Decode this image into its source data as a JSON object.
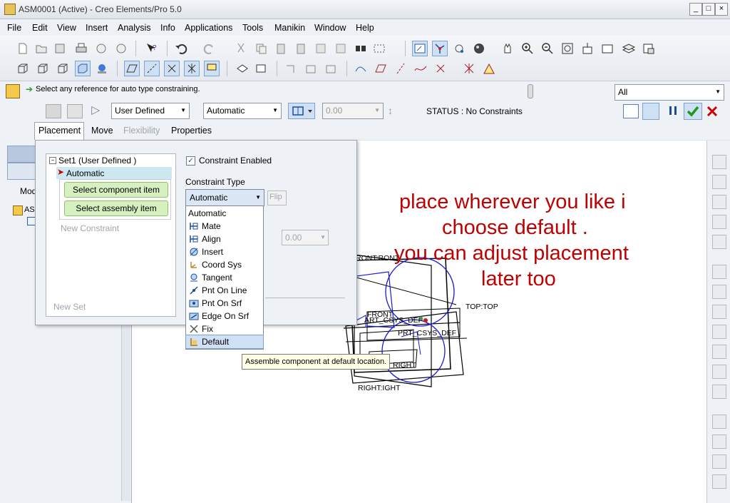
{
  "window": {
    "title": "ASM0001 (Active) - Creo Elements/Pro 5.0",
    "min": "_",
    "max": "□",
    "close": "×"
  },
  "menubar": [
    "File",
    "Edit",
    "View",
    "Insert",
    "Analysis",
    "Info",
    "Applications",
    "Tools",
    "Manikin",
    "Window",
    "Help"
  ],
  "message": {
    "text": "Select any reference for auto type constraining.",
    "filter": "All"
  },
  "dashboard": {
    "set_type": "User Defined",
    "constraint": "Automatic",
    "offset": "0.00",
    "status": "STATUS : No Constraints",
    "tabs": [
      "Placement",
      "Move",
      "Flexibility",
      "Properties"
    ]
  },
  "placement": {
    "set_label": "Set1 (User Defined )",
    "selected_constraint": "Automatic",
    "select_component": "Select component item",
    "select_assembly": "Select assembly item",
    "new_constraint": "New Constraint",
    "new_set": "New Set",
    "constraint_enabled": "Constraint Enabled",
    "constraint_type_label": "Constraint Type",
    "constraint_type_value": "Automatic",
    "flip": "Flip",
    "offset_value": "0.00"
  },
  "constraint_types": [
    {
      "label": "Automatic",
      "icon": ""
    },
    {
      "label": "Mate",
      "icon": "mate-icon"
    },
    {
      "label": "Align",
      "icon": "align-icon"
    },
    {
      "label": "Insert",
      "icon": "insert-icon"
    },
    {
      "label": "Coord Sys",
      "icon": "coord-sys-icon"
    },
    {
      "label": "Tangent",
      "icon": "tangent-icon"
    },
    {
      "label": "Pnt On Line",
      "icon": "pnt-on-line-icon"
    },
    {
      "label": "Pnt On Srf",
      "icon": "pnt-on-srf-icon"
    },
    {
      "label": "Edge On Srf",
      "icon": "edge-on-srf-icon"
    },
    {
      "label": "Fix",
      "icon": "fix-icon"
    },
    {
      "label": "Default",
      "icon": "default-icon"
    }
  ],
  "tooltip": "Assemble component at default location.",
  "model_tree": {
    "header": "Mod",
    "root": "ASI"
  },
  "viewport_labels": {
    "front_top": "RONT:RONT",
    "top": "TOP:TOP",
    "front": "FRONT",
    "csys": "ART_CSYS_DEF",
    "prt_csys": "PRT_CSYS_DEF",
    "right": "RIGHT",
    "right_right": "RIGHT:IGHT"
  },
  "annotation": [
    "place wherever you like i",
    "choose default .",
    "you can adjust placement",
    "later too"
  ],
  "colors": {
    "accent": "#c00000",
    "selection": "#cfe0f5",
    "green": "#d7f0c0"
  }
}
